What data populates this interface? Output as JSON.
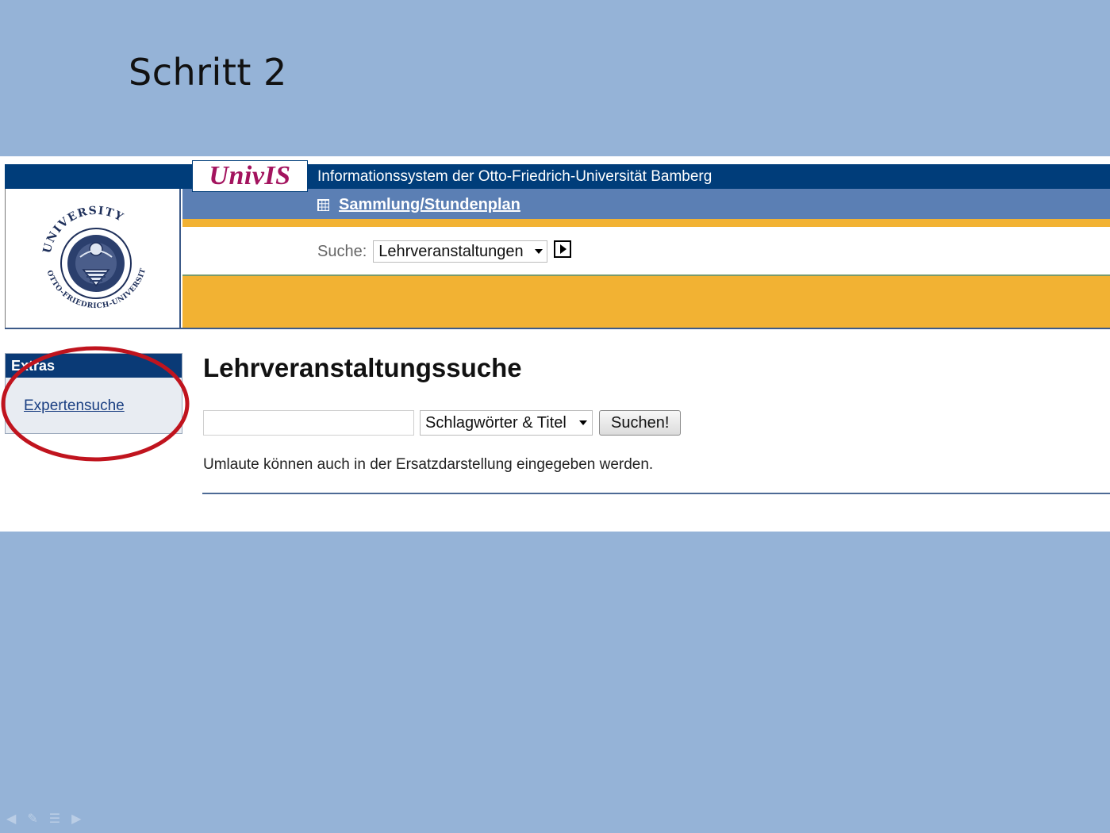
{
  "slide": {
    "title": "Schritt 2"
  },
  "header": {
    "logo_text": "UnivIS",
    "title": "Informationssystem der Otto-Friedrich-Universität Bamberg",
    "nav_link": "Sammlung/Stundenplan",
    "nav_icon": "grid-icon",
    "seal_text_top": "UNIVERSITY",
    "seal_text_outer": "OTTO-FRIEDRICH-UNIVERSITÄT BAMBERG"
  },
  "search": {
    "label": "Suche:",
    "selected": "Lehrveranstaltungen"
  },
  "sidebar": {
    "header": "Extras",
    "link": "Expertensuche"
  },
  "main": {
    "heading": "Lehrveranstaltungssuche",
    "query_value": "",
    "field_selected": "Schlagwörter & Titel",
    "search_button": "Suchen!",
    "hint": "Umlaute können auch in der Ersatzdarstellung eingegeben werden."
  },
  "colors": {
    "slide_bg": "#95b3d7",
    "header_blue": "#003d7a",
    "nav_blue": "#5b7fb4",
    "accent_orange": "#f2b233",
    "logo_magenta": "#a3135e",
    "highlight_red": "#c0141e"
  }
}
